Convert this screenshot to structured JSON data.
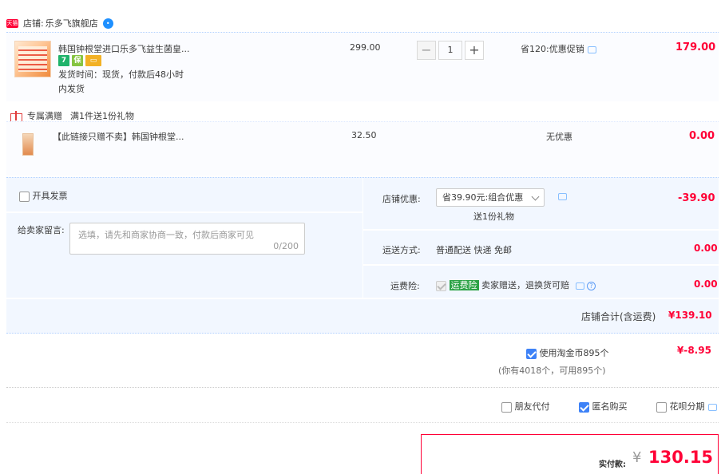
{
  "shop": {
    "badge": "天猫",
    "label": "店铺:",
    "name": "乐多飞旗舰店"
  },
  "items": [
    {
      "title": "韩国钟根堂进口乐多飞益生菌皇...",
      "delivery_line1": "发货时间：现货，付款后48小时",
      "delivery_line2": "内发货",
      "price": "299.00",
      "qty": "1",
      "promo": "省120:优惠促销",
      "amount": "179.00",
      "icons": [
        "seven-day-return-icon",
        "insurance-icon",
        "card-icon"
      ]
    },
    {
      "title": "【此链接只赠不卖】韩国钟根堂...",
      "price": "32.50",
      "promo": "无优惠",
      "amount": "0.00"
    }
  ],
  "gift": {
    "label": "专属满赠",
    "desc": "满1件送1份礼物"
  },
  "options": {
    "invoice_label": "开具发票",
    "message_label": "给卖家留言:",
    "message_placeholder": "选填，请先和商家协商一致，付款后商家可见",
    "message_count": "0/200",
    "discount_label": "店铺优惠:",
    "discount_select": "省39.90元:组合优惠",
    "discount_gift": "送1份礼物",
    "discount_amount": "-39.90",
    "shipping_label": "运送方式:",
    "shipping_value": "普通配送 快递 免邮",
    "shipping_amount": "0.00",
    "insurance_label": "运费险:",
    "insurance_tag": "运费险",
    "insurance_desc": "卖家赠送，退换货可赔",
    "insurance_amount": "0.00",
    "subtotal_label": "店铺合计(含运费)",
    "subtotal_value": "¥139.10"
  },
  "coins": {
    "label": "使用淘金币895个",
    "amount": "¥-8.95",
    "note": "(你有4018个，可用895个)"
  },
  "extra_options": {
    "friend_pay": "朋友代付",
    "anonymous": "匿名购买",
    "huabei": "花呗分期"
  },
  "payment": {
    "label": "实付款:",
    "currency": "¥",
    "amount": "130.15"
  },
  "colors": {
    "accent_red": "#ff0036",
    "orange": "#f0931e",
    "blue": "#3e82f7",
    "panel": "#f2f7ff"
  }
}
